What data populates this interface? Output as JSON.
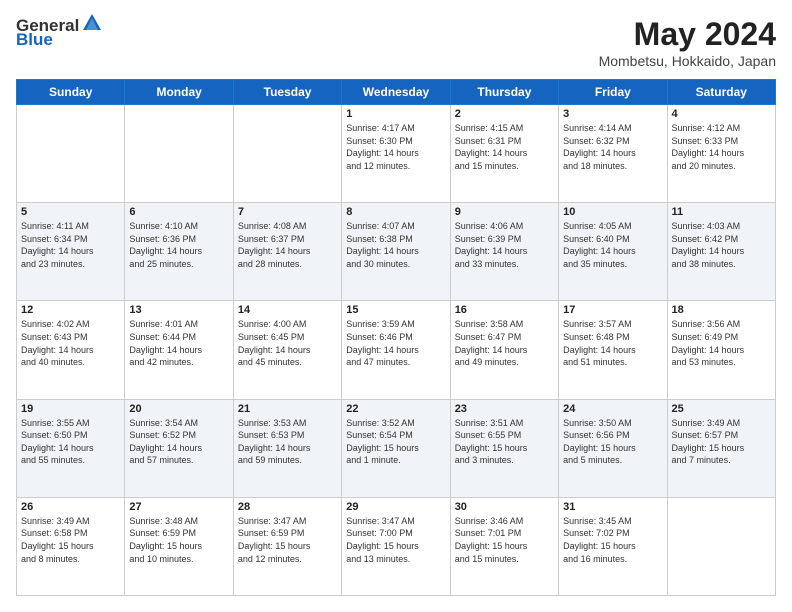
{
  "header": {
    "logo": {
      "text_general": "General",
      "text_blue": "Blue"
    },
    "title": "May 2024",
    "location": "Mombetsu, Hokkaido, Japan"
  },
  "calendar": {
    "days_of_week": [
      "Sunday",
      "Monday",
      "Tuesday",
      "Wednesday",
      "Thursday",
      "Friday",
      "Saturday"
    ],
    "weeks": [
      [
        {
          "day": "",
          "content": ""
        },
        {
          "day": "",
          "content": ""
        },
        {
          "day": "",
          "content": ""
        },
        {
          "day": "1",
          "content": "Sunrise: 4:17 AM\nSunset: 6:30 PM\nDaylight: 14 hours\nand 12 minutes."
        },
        {
          "day": "2",
          "content": "Sunrise: 4:15 AM\nSunset: 6:31 PM\nDaylight: 14 hours\nand 15 minutes."
        },
        {
          "day": "3",
          "content": "Sunrise: 4:14 AM\nSunset: 6:32 PM\nDaylight: 14 hours\nand 18 minutes."
        },
        {
          "day": "4",
          "content": "Sunrise: 4:12 AM\nSunset: 6:33 PM\nDaylight: 14 hours\nand 20 minutes."
        }
      ],
      [
        {
          "day": "5",
          "content": "Sunrise: 4:11 AM\nSunset: 6:34 PM\nDaylight: 14 hours\nand 23 minutes."
        },
        {
          "day": "6",
          "content": "Sunrise: 4:10 AM\nSunset: 6:36 PM\nDaylight: 14 hours\nand 25 minutes."
        },
        {
          "day": "7",
          "content": "Sunrise: 4:08 AM\nSunset: 6:37 PM\nDaylight: 14 hours\nand 28 minutes."
        },
        {
          "day": "8",
          "content": "Sunrise: 4:07 AM\nSunset: 6:38 PM\nDaylight: 14 hours\nand 30 minutes."
        },
        {
          "day": "9",
          "content": "Sunrise: 4:06 AM\nSunset: 6:39 PM\nDaylight: 14 hours\nand 33 minutes."
        },
        {
          "day": "10",
          "content": "Sunrise: 4:05 AM\nSunset: 6:40 PM\nDaylight: 14 hours\nand 35 minutes."
        },
        {
          "day": "11",
          "content": "Sunrise: 4:03 AM\nSunset: 6:42 PM\nDaylight: 14 hours\nand 38 minutes."
        }
      ],
      [
        {
          "day": "12",
          "content": "Sunrise: 4:02 AM\nSunset: 6:43 PM\nDaylight: 14 hours\nand 40 minutes."
        },
        {
          "day": "13",
          "content": "Sunrise: 4:01 AM\nSunset: 6:44 PM\nDaylight: 14 hours\nand 42 minutes."
        },
        {
          "day": "14",
          "content": "Sunrise: 4:00 AM\nSunset: 6:45 PM\nDaylight: 14 hours\nand 45 minutes."
        },
        {
          "day": "15",
          "content": "Sunrise: 3:59 AM\nSunset: 6:46 PM\nDaylight: 14 hours\nand 47 minutes."
        },
        {
          "day": "16",
          "content": "Sunrise: 3:58 AM\nSunset: 6:47 PM\nDaylight: 14 hours\nand 49 minutes."
        },
        {
          "day": "17",
          "content": "Sunrise: 3:57 AM\nSunset: 6:48 PM\nDaylight: 14 hours\nand 51 minutes."
        },
        {
          "day": "18",
          "content": "Sunrise: 3:56 AM\nSunset: 6:49 PM\nDaylight: 14 hours\nand 53 minutes."
        }
      ],
      [
        {
          "day": "19",
          "content": "Sunrise: 3:55 AM\nSunset: 6:50 PM\nDaylight: 14 hours\nand 55 minutes."
        },
        {
          "day": "20",
          "content": "Sunrise: 3:54 AM\nSunset: 6:52 PM\nDaylight: 14 hours\nand 57 minutes."
        },
        {
          "day": "21",
          "content": "Sunrise: 3:53 AM\nSunset: 6:53 PM\nDaylight: 14 hours\nand 59 minutes."
        },
        {
          "day": "22",
          "content": "Sunrise: 3:52 AM\nSunset: 6:54 PM\nDaylight: 15 hours\nand 1 minute."
        },
        {
          "day": "23",
          "content": "Sunrise: 3:51 AM\nSunset: 6:55 PM\nDaylight: 15 hours\nand 3 minutes."
        },
        {
          "day": "24",
          "content": "Sunrise: 3:50 AM\nSunset: 6:56 PM\nDaylight: 15 hours\nand 5 minutes."
        },
        {
          "day": "25",
          "content": "Sunrise: 3:49 AM\nSunset: 6:57 PM\nDaylight: 15 hours\nand 7 minutes."
        }
      ],
      [
        {
          "day": "26",
          "content": "Sunrise: 3:49 AM\nSunset: 6:58 PM\nDaylight: 15 hours\nand 8 minutes."
        },
        {
          "day": "27",
          "content": "Sunrise: 3:48 AM\nSunset: 6:59 PM\nDaylight: 15 hours\nand 10 minutes."
        },
        {
          "day": "28",
          "content": "Sunrise: 3:47 AM\nSunset: 6:59 PM\nDaylight: 15 hours\nand 12 minutes."
        },
        {
          "day": "29",
          "content": "Sunrise: 3:47 AM\nSunset: 7:00 PM\nDaylight: 15 hours\nand 13 minutes."
        },
        {
          "day": "30",
          "content": "Sunrise: 3:46 AM\nSunset: 7:01 PM\nDaylight: 15 hours\nand 15 minutes."
        },
        {
          "day": "31",
          "content": "Sunrise: 3:45 AM\nSunset: 7:02 PM\nDaylight: 15 hours\nand 16 minutes."
        },
        {
          "day": "",
          "content": ""
        }
      ]
    ]
  }
}
